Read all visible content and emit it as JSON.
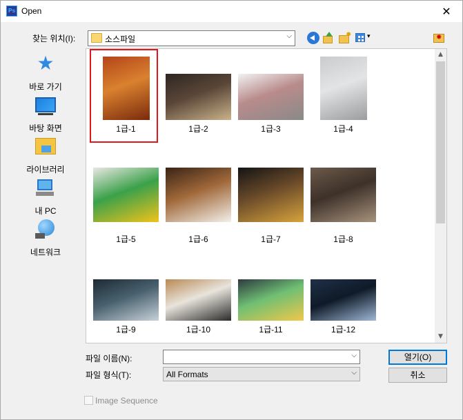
{
  "window": {
    "app_icon_text": "Ps",
    "title": "Open",
    "close_glyph": "✕"
  },
  "toolbar": {
    "lookin_label": "찾는 위치(I):",
    "lookin_value": "소스파일",
    "combo_arrow": "⌵",
    "icons": [
      "back-icon",
      "up-folder-icon",
      "new-folder-icon",
      "view-menu-icon",
      "favorite-folder-icon"
    ],
    "view_dropdown_glyph": "▾"
  },
  "sidebar": {
    "items": [
      {
        "label": "바로 가기",
        "icon": "quick-access-star-icon",
        "icon_glyph": "★"
      },
      {
        "label": "바탕 화면",
        "icon": "desktop-icon"
      },
      {
        "label": "라이브러리",
        "icon": "library-icon"
      },
      {
        "label": "내 PC",
        "icon": "pc-icon"
      },
      {
        "label": "네트워크",
        "icon": "network-icon"
      }
    ]
  },
  "files": [
    {
      "label": "1급-1",
      "selected": true,
      "colors": [
        "#b4451a",
        "#7a2a0c",
        "#d9812f"
      ]
    },
    {
      "label": "1급-2",
      "selected": false,
      "colors": [
        "#2d2621",
        "#c9b28a",
        "#5a4638"
      ]
    },
    {
      "label": "1급-3",
      "selected": false,
      "colors": [
        "#f2f2f2",
        "#8a8a8a",
        "#b98b8b"
      ]
    },
    {
      "label": "1급-4",
      "selected": false,
      "colors": [
        "#c9cbcd",
        "#9a9c9f",
        "#e3e4e5"
      ]
    },
    {
      "label": "1급-5",
      "selected": false,
      "colors": [
        "#e9e7e2",
        "#f1c21b",
        "#3aa14a"
      ]
    },
    {
      "label": "1급-6",
      "selected": false,
      "colors": [
        "#3a2415",
        "#f3f0ea",
        "#a0683a"
      ]
    },
    {
      "label": "1급-7",
      "selected": false,
      "colors": [
        "#141414",
        "#d7a33c",
        "#6a4a2a"
      ]
    },
    {
      "label": "1급-8",
      "selected": false,
      "colors": [
        "#6d5a4a",
        "#a8927d",
        "#3d3129"
      ]
    },
    {
      "label": "1급-9",
      "selected": false,
      "colors": [
        "#1d2a33",
        "#c7d1d8",
        "#48606e"
      ]
    },
    {
      "label": "1급-10",
      "selected": false,
      "colors": [
        "#b98a55",
        "#2b2b2b",
        "#e8e4dc"
      ]
    },
    {
      "label": "1급-11",
      "selected": false,
      "colors": [
        "#2d3a40",
        "#f0c84a",
        "#6fbf73"
      ]
    },
    {
      "label": "1급-12",
      "selected": false,
      "colors": [
        "#1f3048",
        "#9fb8d6",
        "#0f1a28"
      ]
    }
  ],
  "scrollbar": {
    "up_glyph": "▲",
    "down_glyph": "▼"
  },
  "form": {
    "filename_label": "파일 이름(N):",
    "filename_value": "",
    "filetype_label": "파일 형식(T):",
    "filetype_value": "All Formats",
    "combo_arrow": "⌵"
  },
  "buttons": {
    "open_label": "열기(O)",
    "cancel_label": "취소"
  },
  "image_sequence": {
    "label": "Image Sequence",
    "checked": false,
    "enabled": false
  },
  "colors": {
    "selection_outline": "#e0161c",
    "accent": "#0078d7"
  }
}
